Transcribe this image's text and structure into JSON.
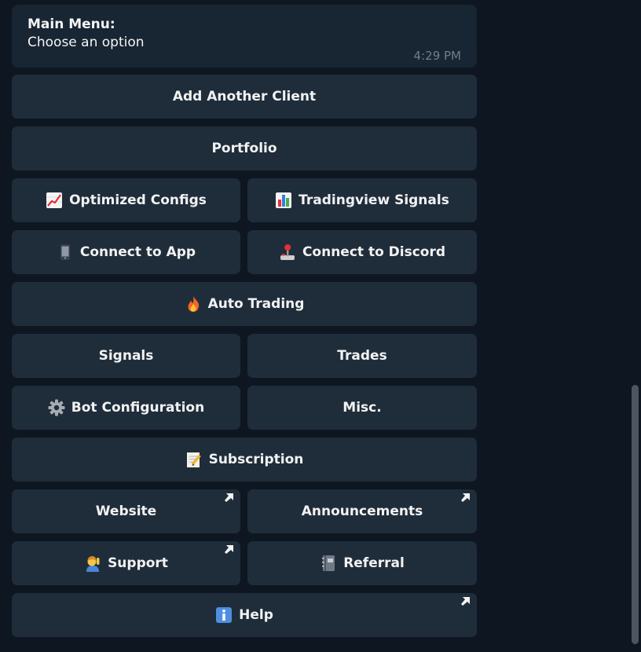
{
  "message": {
    "title": "Main Menu:",
    "text": "Choose an option",
    "time": "4:29 PM"
  },
  "buttons": {
    "add_client": "Add Another Client",
    "portfolio": "Portfolio",
    "optimized_configs": "Optimized Configs",
    "tradingview_signals": "Tradingview Signals",
    "connect_app": "Connect to App",
    "connect_discord": "Connect to Discord",
    "auto_trading": "Auto Trading",
    "signals": "Signals",
    "trades": "Trades",
    "bot_configuration": "Bot Configuration",
    "misc": "Misc.",
    "subscription": "Subscription",
    "website": "Website",
    "announcements": "Announcements",
    "support": "Support",
    "referral": "Referral",
    "help": "Help"
  },
  "icons": {
    "optimized_configs": "chart-increasing-icon",
    "tradingview_signals": "bar-chart-icon",
    "connect_app": "mobile-phone-icon",
    "connect_discord": "joystick-icon",
    "auto_trading": "fire-icon",
    "bot_configuration": "gear-icon",
    "subscription": "memo-icon",
    "support": "person-raising-hand-icon",
    "referral": "notebook-icon",
    "help": "information-icon",
    "external_link": "external-link-arrow-icon"
  },
  "colors": {
    "background": "#0e1621",
    "bubble": "#182533",
    "button": "#1f2d3b",
    "text": "#f2f2f2",
    "time": "#6d7f8f"
  }
}
